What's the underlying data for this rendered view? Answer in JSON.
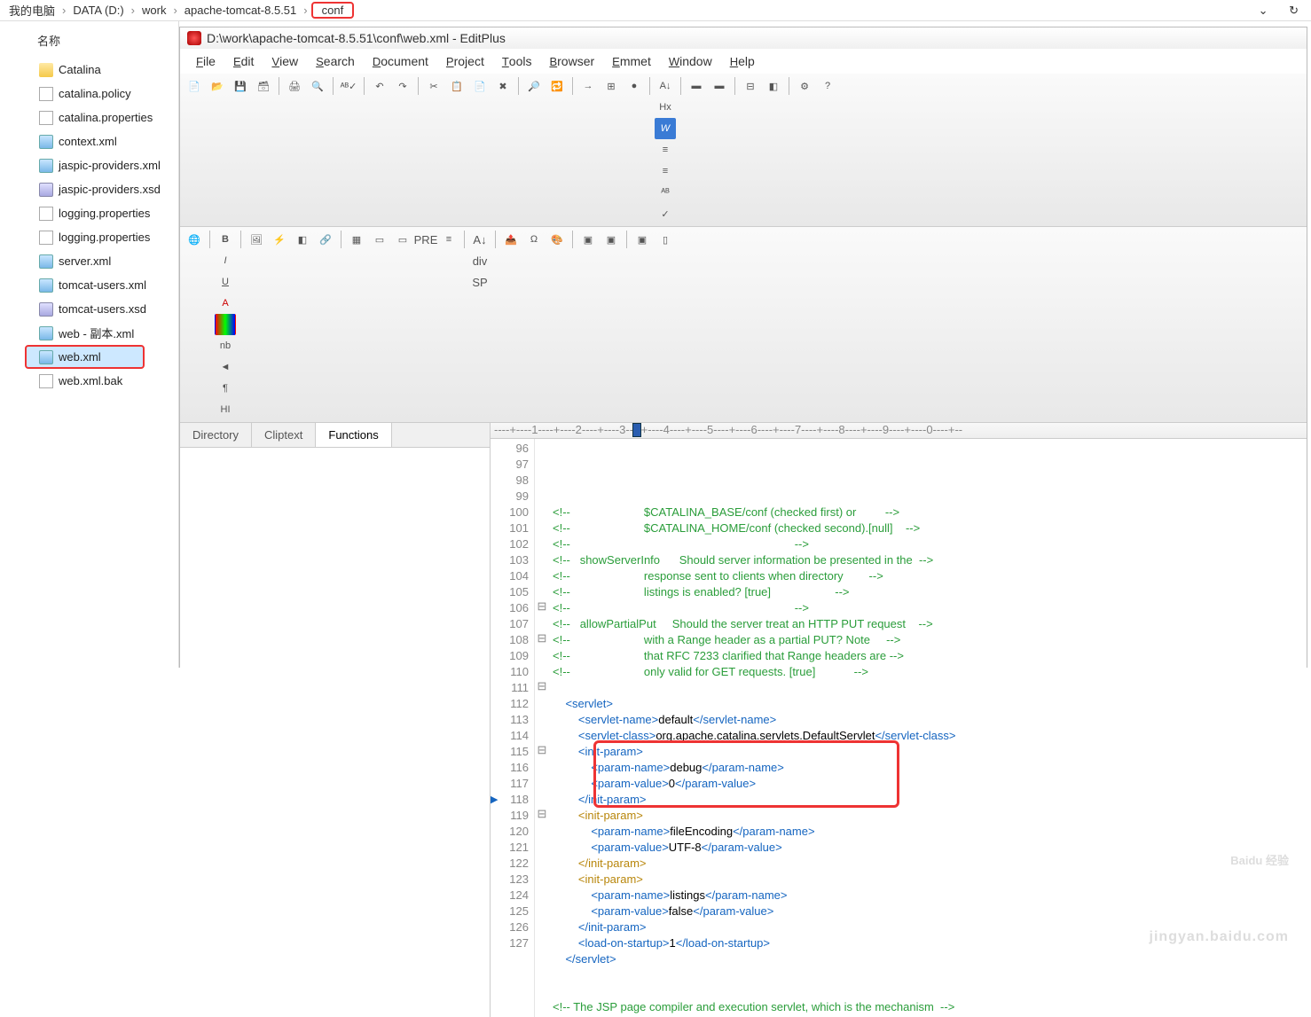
{
  "breadcrumb": {
    "items": [
      "我的电脑",
      "DATA (D:)",
      "work",
      "apache-tomcat-8.5.51",
      "conf"
    ],
    "highlighted_index": 4
  },
  "explorer": {
    "header": "名称",
    "files": [
      {
        "name": "Catalina",
        "type": "folder"
      },
      {
        "name": "catalina.policy",
        "type": "file"
      },
      {
        "name": "catalina.properties",
        "type": "file"
      },
      {
        "name": "context.xml",
        "type": "xml"
      },
      {
        "name": "jaspic-providers.xml",
        "type": "xml"
      },
      {
        "name": "jaspic-providers.xsd",
        "type": "xsd"
      },
      {
        "name": "logging.properties",
        "type": "file"
      },
      {
        "name": "logging.properties",
        "type": "file"
      },
      {
        "name": "server.xml",
        "type": "xml"
      },
      {
        "name": "tomcat-users.xml",
        "type": "xml"
      },
      {
        "name": "tomcat-users.xsd",
        "type": "xsd"
      },
      {
        "name": "web - 副本.xml",
        "type": "xml"
      },
      {
        "name": "web.xml",
        "type": "xml",
        "selected": true,
        "highlighted": true
      },
      {
        "name": "web.xml.bak",
        "type": "file"
      }
    ]
  },
  "editor": {
    "title": "D:\\work\\apache-tomcat-8.5.51\\conf\\web.xml - EditPlus",
    "menus": [
      "File",
      "Edit",
      "View",
      "Search",
      "Document",
      "Project",
      "Tools",
      "Browser",
      "Emmet",
      "Window",
      "Help"
    ],
    "side_tabs": [
      "Directory",
      "Cliptext",
      "Functions"
    ],
    "active_side_tab": 2,
    "ruler": "----+----1----+----2----+----3----+----4----+----5----+----6----+----7----+----8----+----9----+----0----+--",
    "first_line": 96,
    "lines": [
      {
        "n": 96,
        "f": "",
        "html": "<span class='cm'>&lt;!--                       $CATALINA_BASE/conf (checked first) or         --&gt;</span>"
      },
      {
        "n": 97,
        "f": "",
        "html": "<span class='cm'>&lt;!--                       $CATALINA_HOME/conf (checked second).[null]    --&gt;</span>"
      },
      {
        "n": 98,
        "f": "",
        "html": "<span class='cm'>&lt;!--                                                                      --&gt;</span>"
      },
      {
        "n": 99,
        "f": "",
        "html": "<span class='cm'>&lt;!--   showServerInfo      Should server information be presented in the  --&gt;</span>"
      },
      {
        "n": 100,
        "f": "",
        "html": "<span class='cm'>&lt;!--                       response sent to clients when directory        --&gt;</span>"
      },
      {
        "n": 101,
        "f": "",
        "html": "<span class='cm'>&lt;!--                       listings is enabled? [true]                    --&gt;</span>"
      },
      {
        "n": 102,
        "f": "",
        "html": "<span class='cm'>&lt;!--                                                                      --&gt;</span>"
      },
      {
        "n": 103,
        "f": "",
        "html": "<span class='cm'>&lt;!--   allowPartialPut     Should the server treat an HTTP PUT request    --&gt;</span>"
      },
      {
        "n": 104,
        "f": "",
        "html": "<span class='cm'>&lt;!--                       with a Range header as a partial PUT? Note     --&gt;</span>"
      },
      {
        "n": 105,
        "f": "",
        "html": "<span class='cm'>&lt;!--                       that RFC 7233 clarified that Range headers are --&gt;</span>"
      },
      {
        "n": 106,
        "f": "⊟",
        "html": "<span class='cm'>&lt;!--                       only valid for GET requests. [true]            --&gt;</span>"
      },
      {
        "n": 107,
        "f": "",
        "html": ""
      },
      {
        "n": 108,
        "f": "⊟",
        "html": "    <span class='tg'>&lt;servlet&gt;</span>"
      },
      {
        "n": 109,
        "f": "",
        "html": "        <span class='tg'>&lt;servlet-name&gt;</span><span class='tx'>default</span><span class='tg'>&lt;/servlet-name&gt;</span>"
      },
      {
        "n": 110,
        "f": "",
        "html": "        <span class='tg'>&lt;servlet-class&gt;</span><span class='tx'>org.apache.catalina.servlets.DefaultServlet</span><span class='tg'>&lt;/servlet-class&gt;</span>"
      },
      {
        "n": 111,
        "f": "⊟",
        "html": "        <span class='tg'>&lt;init-param&gt;</span>"
      },
      {
        "n": 112,
        "f": "",
        "html": "            <span class='tg'>&lt;param-name&gt;</span><span class='tx'>debug</span><span class='tg'>&lt;/param-name&gt;</span>"
      },
      {
        "n": 113,
        "f": "",
        "html": "            <span class='tg'>&lt;param-value&gt;</span><span class='tx'>0</span><span class='tg'>&lt;/param-value&gt;</span>"
      },
      {
        "n": 114,
        "f": "",
        "html": "        <span class='tg'>&lt;/init-param&gt;</span>"
      },
      {
        "n": 115,
        "f": "⊟",
        "html": "        <span class='tg2'>&lt;init-param&gt;</span>"
      },
      {
        "n": 116,
        "f": "",
        "html": "            <span class='tg'>&lt;param-name&gt;</span><span class='tx'>fileEncoding</span><span class='tg'>&lt;/param-name&gt;</span>"
      },
      {
        "n": 117,
        "f": "",
        "html": "            <span class='tg'>&lt;param-value&gt;</span><span class='tx'>UTF-8</span><span class='tg'>&lt;/param-value&gt;</span>"
      },
      {
        "n": 118,
        "f": "",
        "html": "        <span class='tg2'>&lt;/init-param&gt;</span>",
        "arrow": true
      },
      {
        "n": 119,
        "f": "⊟",
        "html": "        <span class='tg2'>&lt;init-param&gt;</span>"
      },
      {
        "n": 120,
        "f": "",
        "html": "            <span class='tg'>&lt;param-name&gt;</span><span class='tx'>listings</span><span class='tg'>&lt;/param-name&gt;</span>"
      },
      {
        "n": 121,
        "f": "",
        "html": "            <span class='tg'>&lt;param-value&gt;</span><span class='tx'>false</span><span class='tg'>&lt;/param-value&gt;</span>"
      },
      {
        "n": 122,
        "f": "",
        "html": "        <span class='tg'>&lt;/init-param&gt;</span>"
      },
      {
        "n": 123,
        "f": "",
        "html": "        <span class='tg'>&lt;load-on-startup&gt;</span><span class='tx'>1</span><span class='tg'>&lt;/load-on-startup&gt;</span>"
      },
      {
        "n": 124,
        "f": "",
        "html": "    <span class='tg'>&lt;/servlet&gt;</span>"
      },
      {
        "n": 125,
        "f": "",
        "html": ""
      },
      {
        "n": 126,
        "f": "",
        "html": ""
      },
      {
        "n": 127,
        "f": "",
        "html": "<span class='cm'>&lt;!-- The JSP page compiler and execution servlet, which is the mechanism  --&gt;</span>"
      }
    ],
    "highlight_box": {
      "top_line": 115,
      "bottom_line": 118
    },
    "toolbar_format_labels": [
      "B",
      "I",
      "U",
      "A",
      "■",
      "nb",
      "◄",
      "¶",
      "HI"
    ],
    "toolbar_labels2": [
      "A↓",
      "Hx",
      "W",
      "≡",
      "≡",
      "ᴬᴮ",
      "✓"
    ],
    "toolbar_labels3": [
      "A↓",
      "div",
      "SP"
    ],
    "watermark": {
      "main": "Baidu 经验",
      "sub": "jingyan.baidu.com"
    }
  }
}
